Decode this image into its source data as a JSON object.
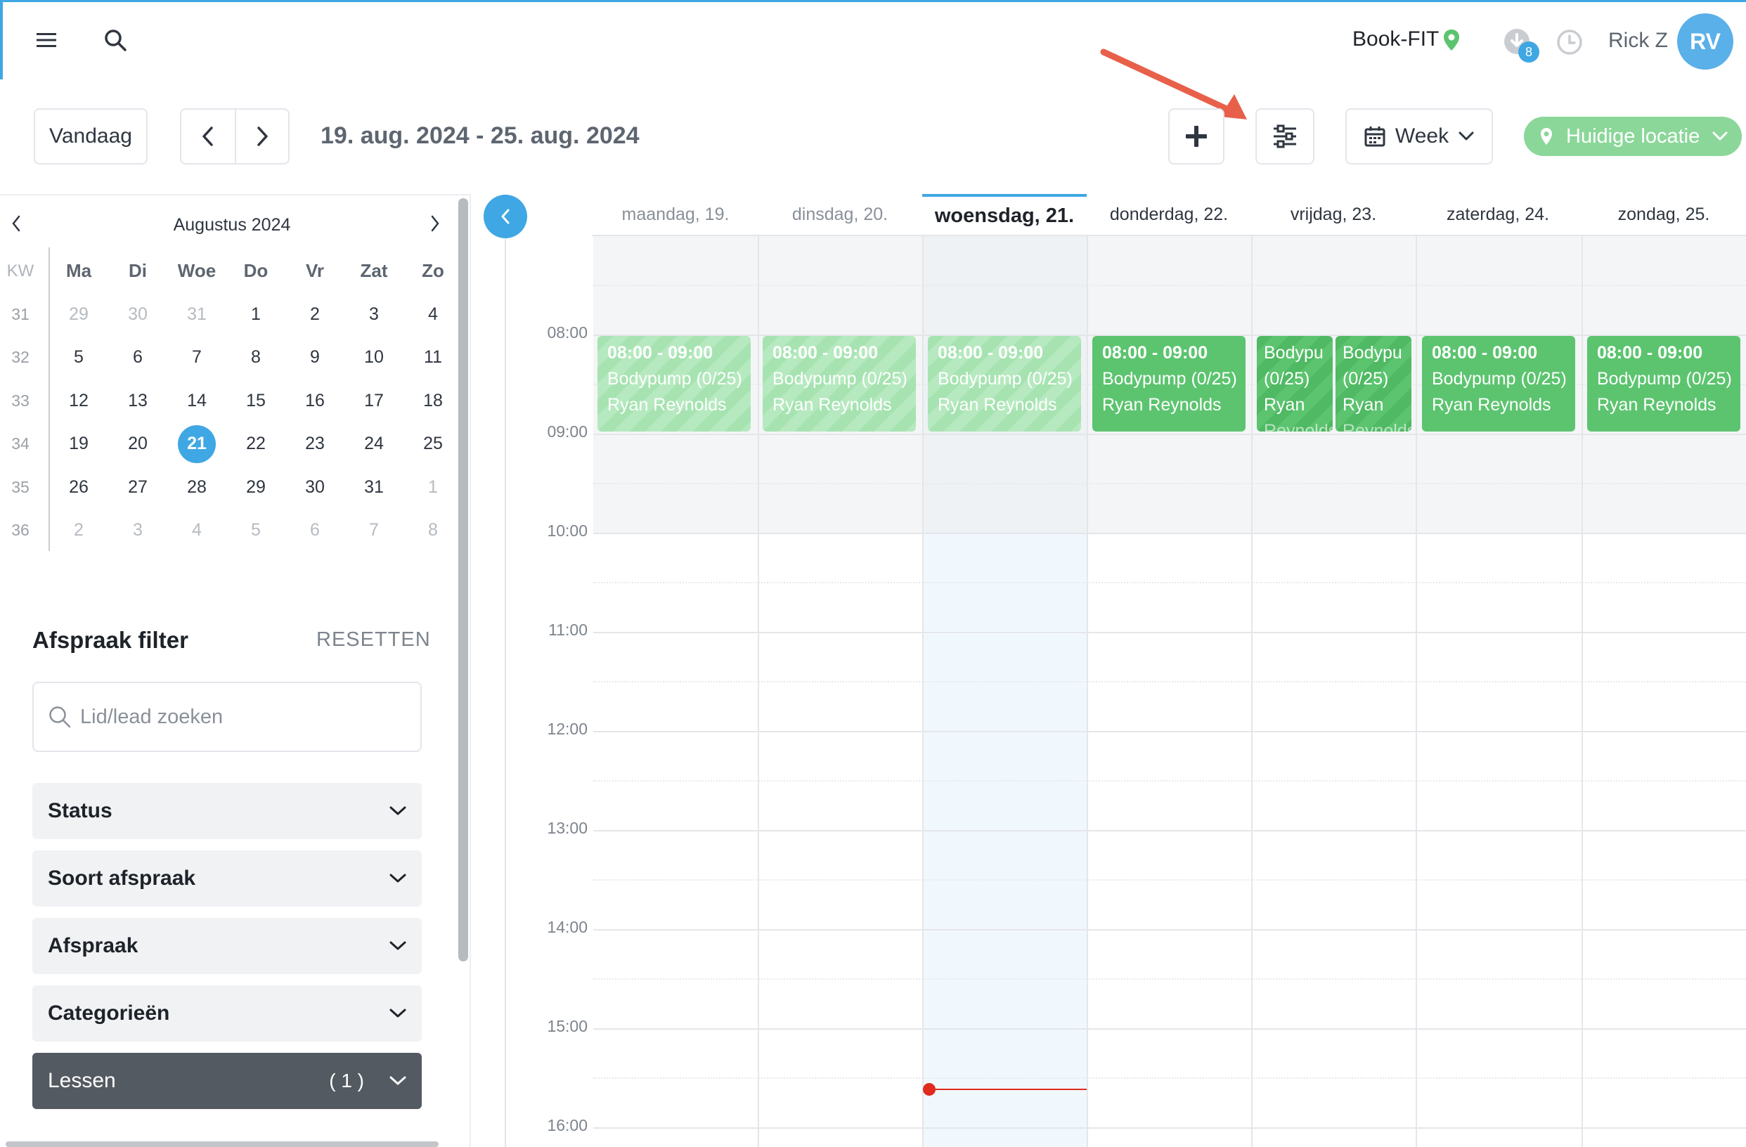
{
  "topbar": {
    "brand": "Book-FIT",
    "notifications_count": "8",
    "user_name": "Rick Z",
    "avatar_initials": "RV"
  },
  "toolbar": {
    "today_label": "Vandaag",
    "date_range": "19. aug. 2024 - 25. aug. 2024",
    "view_label": "Week",
    "location_label": "Huidige locatie"
  },
  "mini_calendar": {
    "month_label": "Augustus 2024",
    "kw_label": "KW",
    "weekdays": [
      "Ma",
      "Di",
      "Woe",
      "Do",
      "Vr",
      "Zat",
      "Zo"
    ],
    "weeks": [
      {
        "kw": "31",
        "days": [
          "29",
          "30",
          "31",
          "1",
          "2",
          "3",
          "4"
        ]
      },
      {
        "kw": "32",
        "days": [
          "5",
          "6",
          "7",
          "8",
          "9",
          "10",
          "11"
        ]
      },
      {
        "kw": "33",
        "days": [
          "12",
          "13",
          "14",
          "15",
          "16",
          "17",
          "18"
        ]
      },
      {
        "kw": "34",
        "days": [
          "19",
          "20",
          "21",
          "22",
          "23",
          "24",
          "25"
        ]
      },
      {
        "kw": "35",
        "days": [
          "26",
          "27",
          "28",
          "29",
          "30",
          "31",
          "1"
        ]
      },
      {
        "kw": "36",
        "days": [
          "2",
          "3",
          "4",
          "5",
          "6",
          "7",
          "8"
        ]
      }
    ],
    "selected_day": "21"
  },
  "filter": {
    "title": "Afspraak filter",
    "reset_label": "RESETTEN",
    "search_placeholder": "Lid/lead zoeken",
    "sections": [
      {
        "label": "Status"
      },
      {
        "label": "Soort afspraak"
      },
      {
        "label": "Afspraak"
      },
      {
        "label": "Categorieën"
      },
      {
        "label": "Lessen",
        "count": "( 1 )"
      }
    ]
  },
  "calendar": {
    "days": [
      {
        "label": "maandag, 19."
      },
      {
        "label": "dinsdag, 20."
      },
      {
        "label": "woensdag, 21."
      },
      {
        "label": "donderdag, 22."
      },
      {
        "label": "vrijdag, 23."
      },
      {
        "label": "zaterdag, 24."
      },
      {
        "label": "zondag, 25."
      }
    ],
    "times": [
      "08:00",
      "09:00",
      "10:00",
      "11:00",
      "12:00",
      "13:00",
      "14:00",
      "15:00",
      "16:00"
    ],
    "events": [
      {
        "time": "08:00 - 09:00",
        "title": "Bodypump (0/25)",
        "trainer": "Ryan Reynolds"
      },
      {
        "time": "08:00 - 09:00",
        "title": "Bodypump (0/25)",
        "trainer": "Ryan Reynolds"
      },
      {
        "time": "08:00 - 09:00",
        "title": "Bodypump (0/25)",
        "trainer": "Ryan Reynolds"
      },
      {
        "time": "08:00 - 09:00",
        "title": "Bodypump (0/25)",
        "trainer": "Ryan Reynolds"
      },
      {
        "title": "Bodypu",
        "subtitle": "(0/25)",
        "trainer": "Ryan",
        "trainer2": "Reynolds"
      },
      {
        "title": "Bodypu",
        "subtitle": "(0/25)",
        "trainer": "Ryan",
        "trainer2": "Reynolds"
      },
      {
        "time": "08:00 - 09:00",
        "title": "Bodypump (0/25)",
        "trainer": "Ryan Reynolds"
      },
      {
        "time": "08:00 - 09:00",
        "title": "Bodypump (0/25)",
        "trainer": "Ryan Reynolds"
      }
    ]
  },
  "colors": {
    "accent": "#3fa7e3",
    "event_green": "#5cc46f",
    "event_past": "#a6e3b1",
    "location_pill": "#8bd79a",
    "now_line": "#e02b1e"
  }
}
